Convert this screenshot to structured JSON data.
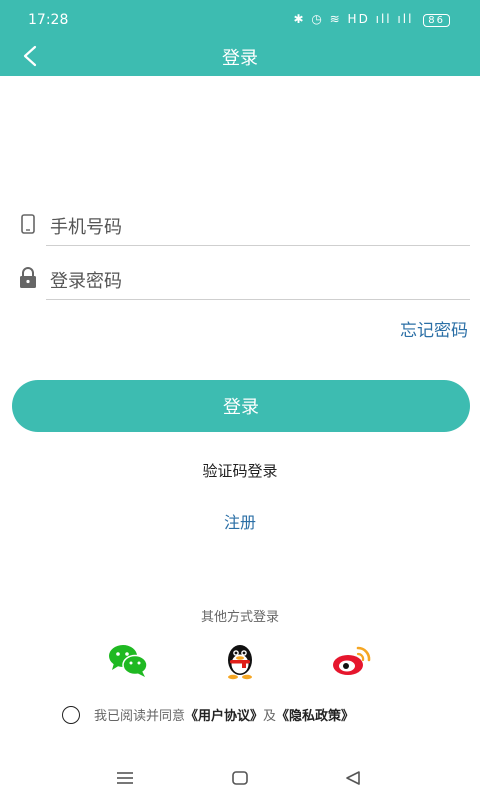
{
  "status_bar": {
    "time": "17:28",
    "icons": "✱ ◷ ≋ HD ıll ıll",
    "battery": "86"
  },
  "nav": {
    "title": "登录"
  },
  "form": {
    "phone_placeholder": "手机号码",
    "password_placeholder": "登录密码",
    "forgot_label": "忘记密码",
    "login_label": "登录",
    "sms_login_label": "验证码登录",
    "register_label": "注册"
  },
  "other_login": {
    "label": "其他方式登录",
    "methods": [
      "wechat-icon",
      "qq-icon",
      "weibo-icon"
    ]
  },
  "agreement": {
    "prefix": "我已阅读并同意",
    "user_agreement": "《用户协议》",
    "conjunction": "及",
    "privacy_policy": "《隐私政策》"
  },
  "colors": {
    "primary": "#3dbcb1",
    "link": "#2b6fa6"
  }
}
